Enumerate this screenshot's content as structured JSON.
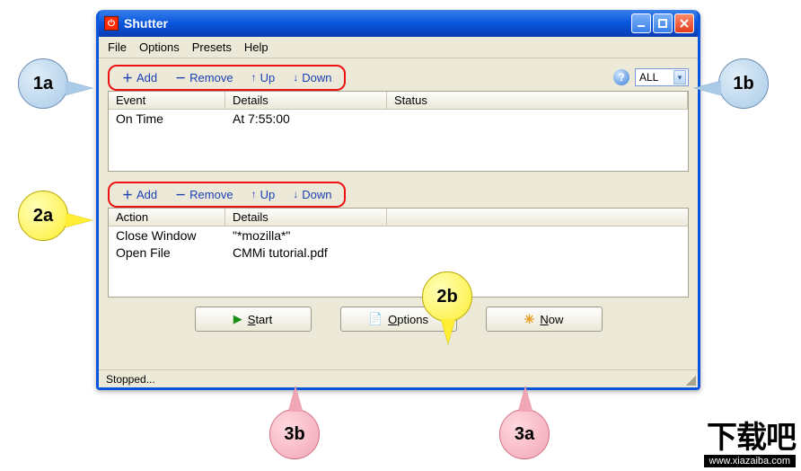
{
  "callouts": {
    "c1a": "1a",
    "c1b": "1b",
    "c2a": "2a",
    "c2b": "2b",
    "c3a": "3a",
    "c3b": "3b"
  },
  "window": {
    "title": "Shutter"
  },
  "menubar": [
    "File",
    "Options",
    "Presets",
    "Help"
  ],
  "toolbar": {
    "add": "Add",
    "remove": "Remove",
    "up": "Up",
    "down": "Down"
  },
  "combo": {
    "value": "ALL"
  },
  "events_grid": {
    "headers": {
      "event": "Event",
      "details": "Details",
      "status": "Status"
    },
    "rows": [
      {
        "event": "On Time",
        "details": "At 7:55:00",
        "status": ""
      }
    ]
  },
  "actions_grid": {
    "headers": {
      "action": "Action",
      "details": "Details"
    },
    "rows": [
      {
        "action": "Close Window",
        "details": "\"*mozilla*\""
      },
      {
        "action": "Open File",
        "details": "CMMi tutorial.pdf"
      }
    ]
  },
  "buttons": {
    "start": "Start",
    "options": "Options",
    "now": "Now"
  },
  "statusbar": "Stopped...",
  "watermark": {
    "big": "下载吧",
    "small": "www.xiazaiba.com"
  }
}
